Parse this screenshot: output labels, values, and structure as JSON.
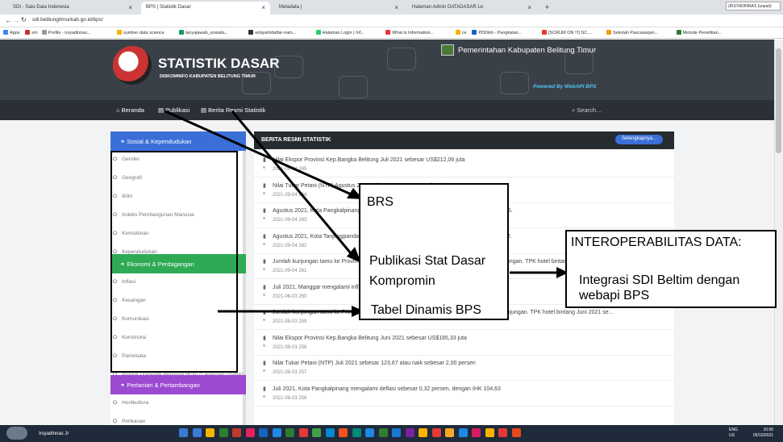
{
  "browser": {
    "tabs": [
      {
        "label": "SDI - Satu Data Indonesia",
        "active": false
      },
      {
        "label": "BPS | Statistik Dasar",
        "active": true
      },
      {
        "label": "Metadata |",
        "active": false
      },
      {
        "label": "Halaman Admin DATADASAR Le",
        "active": false
      }
    ],
    "new_tab": "+",
    "url": "sdi.belitungtimurkab.go.id/bps/",
    "profile": "(IRSYADINNAS (unpad)",
    "bookmarks": [
      "Apps",
      "sm",
      "Profile - irsyadinnas...",
      "sumber data science",
      "tanyajawab_sosialis...",
      "wilayah/daftar-nam...",
      "Halaman Login | Inf...",
      "What is Information...",
      "ce",
      "PDDikti - Pangkalan...",
      "[SCRUM ON !!!] SC...",
      "Sekolah Pascasarjan...",
      "Metode Penelitian..."
    ]
  },
  "header": {
    "title": "STATISTIK DASAR",
    "subtitle": "DISKOMINFO KABUPATEN BELITUNG TIMUR",
    "gov": "Pemerintahan Kabupaten Belitung Timur",
    "powered": "Powered By WebAPI BPS"
  },
  "nav": {
    "items": [
      "Beranda",
      "Publikasi",
      "Berita Resmi Statistik"
    ],
    "search": "Search..."
  },
  "categories": [
    {
      "title": "Sosial & Kependudukan",
      "color": "#3b6fd8",
      "items": [
        "Gender",
        "Geografi",
        "Iklim",
        "Indeks Pembangunan Manusia",
        "Kemiskinan",
        "Kependudukan"
      ]
    },
    {
      "title": "Ekonomi & Perdagangan",
      "color": "#2eaa55",
      "items": [
        "Inflasi",
        "Keuangan",
        "Komunikasi",
        "Konstruksi",
        "Pariwisata",
        "Produk Domestik Regional Bruto (Lapangan Usaha)"
      ]
    },
    {
      "title": "Pertanian & Pertambangan",
      "color": "#9b4ad1",
      "items": [
        "Hortikultura",
        "Perikanan"
      ]
    }
  ],
  "news": {
    "heading": "BERITA RESMI STATISTIK",
    "more": "Selengkapnya...",
    "rows": [
      {
        "title": "Nilai Ekspor Provinsi Kep.Bangka Belitung Juli 2021 sebesar US$212,06 juta",
        "date": "2021-09-04 265"
      },
      {
        "title": "Nilai Tukar Petani (NTP) Agustus 2021 sebesar 120,22 atau naik sebesar 0,08 persen",
        "date": "2021-09-04 264"
      },
      {
        "title": "Agustus 2021, Kota Pangkalpinang mengalami deflasi sebesar 0,27 persen dengan IHK 104,35.",
        "date": "2021-09-04 263"
      },
      {
        "title": "Agustus 2021, Kota Tanjungpandan mengalami inflasi sebesar 0,28 persen dengan IHK 109,32.",
        "date": "2021-09-04 262"
      },
      {
        "title": "Jumlah kunjungan tamu ke Provinsi Kepulauan Bangka Belitung Juli 2021 sebesar 0,000 kunjungan. TPK hotel bintang Juli 2021 sebe...",
        "date": "2021-09-04 261"
      },
      {
        "title": "Juli 2021, Manggar mengalami inflasi sebesar 0,74 persen dengan IHK 107,50",
        "date": "2021-08-03 260"
      },
      {
        "title": "Jumlah kunjungan tamu ke Provinsi Kepulauan Bangka Belitung Juni 2021 sebesar 26.647 kunjungan. TPK hotel bintang Juni 2021 se...",
        "date": "2021-08-03 259"
      },
      {
        "title": "Nilai Ekspor Provinsi Kep.Bangka Belitung Juni 2021 sebesar US$185,33 juta",
        "date": "2021-08-03 258"
      },
      {
        "title": "Nilai Tukar Petani (NTP) Juli 2021 sebesar 123,67 atau naik sebesar 2,00 persen",
        "date": "2021-08-03 257"
      },
      {
        "title": "Juli 2021, Kota Pangkalpinang mengalami deflasi sebesar 0,32 persen, dengan IHK 104,63",
        "date": "2021-08-03 256"
      }
    ]
  },
  "annotations": {
    "brs": "BRS",
    "publikasi": "Publikasi Stat Dasar",
    "kompromin": "Kompromin",
    "tabel": "Tabel Dinamis BPS",
    "interop": "INTEROPERABILITAS  DATA:",
    "integrasi": "Integrasi SDI Beltim dengan",
    "webapi": "webapi BPS"
  },
  "taskbar": {
    "user": "Irsyadinnas Jr",
    "lang": [
      "ENG",
      "US"
    ],
    "time": "10:00",
    "date": "05/10/2021"
  }
}
